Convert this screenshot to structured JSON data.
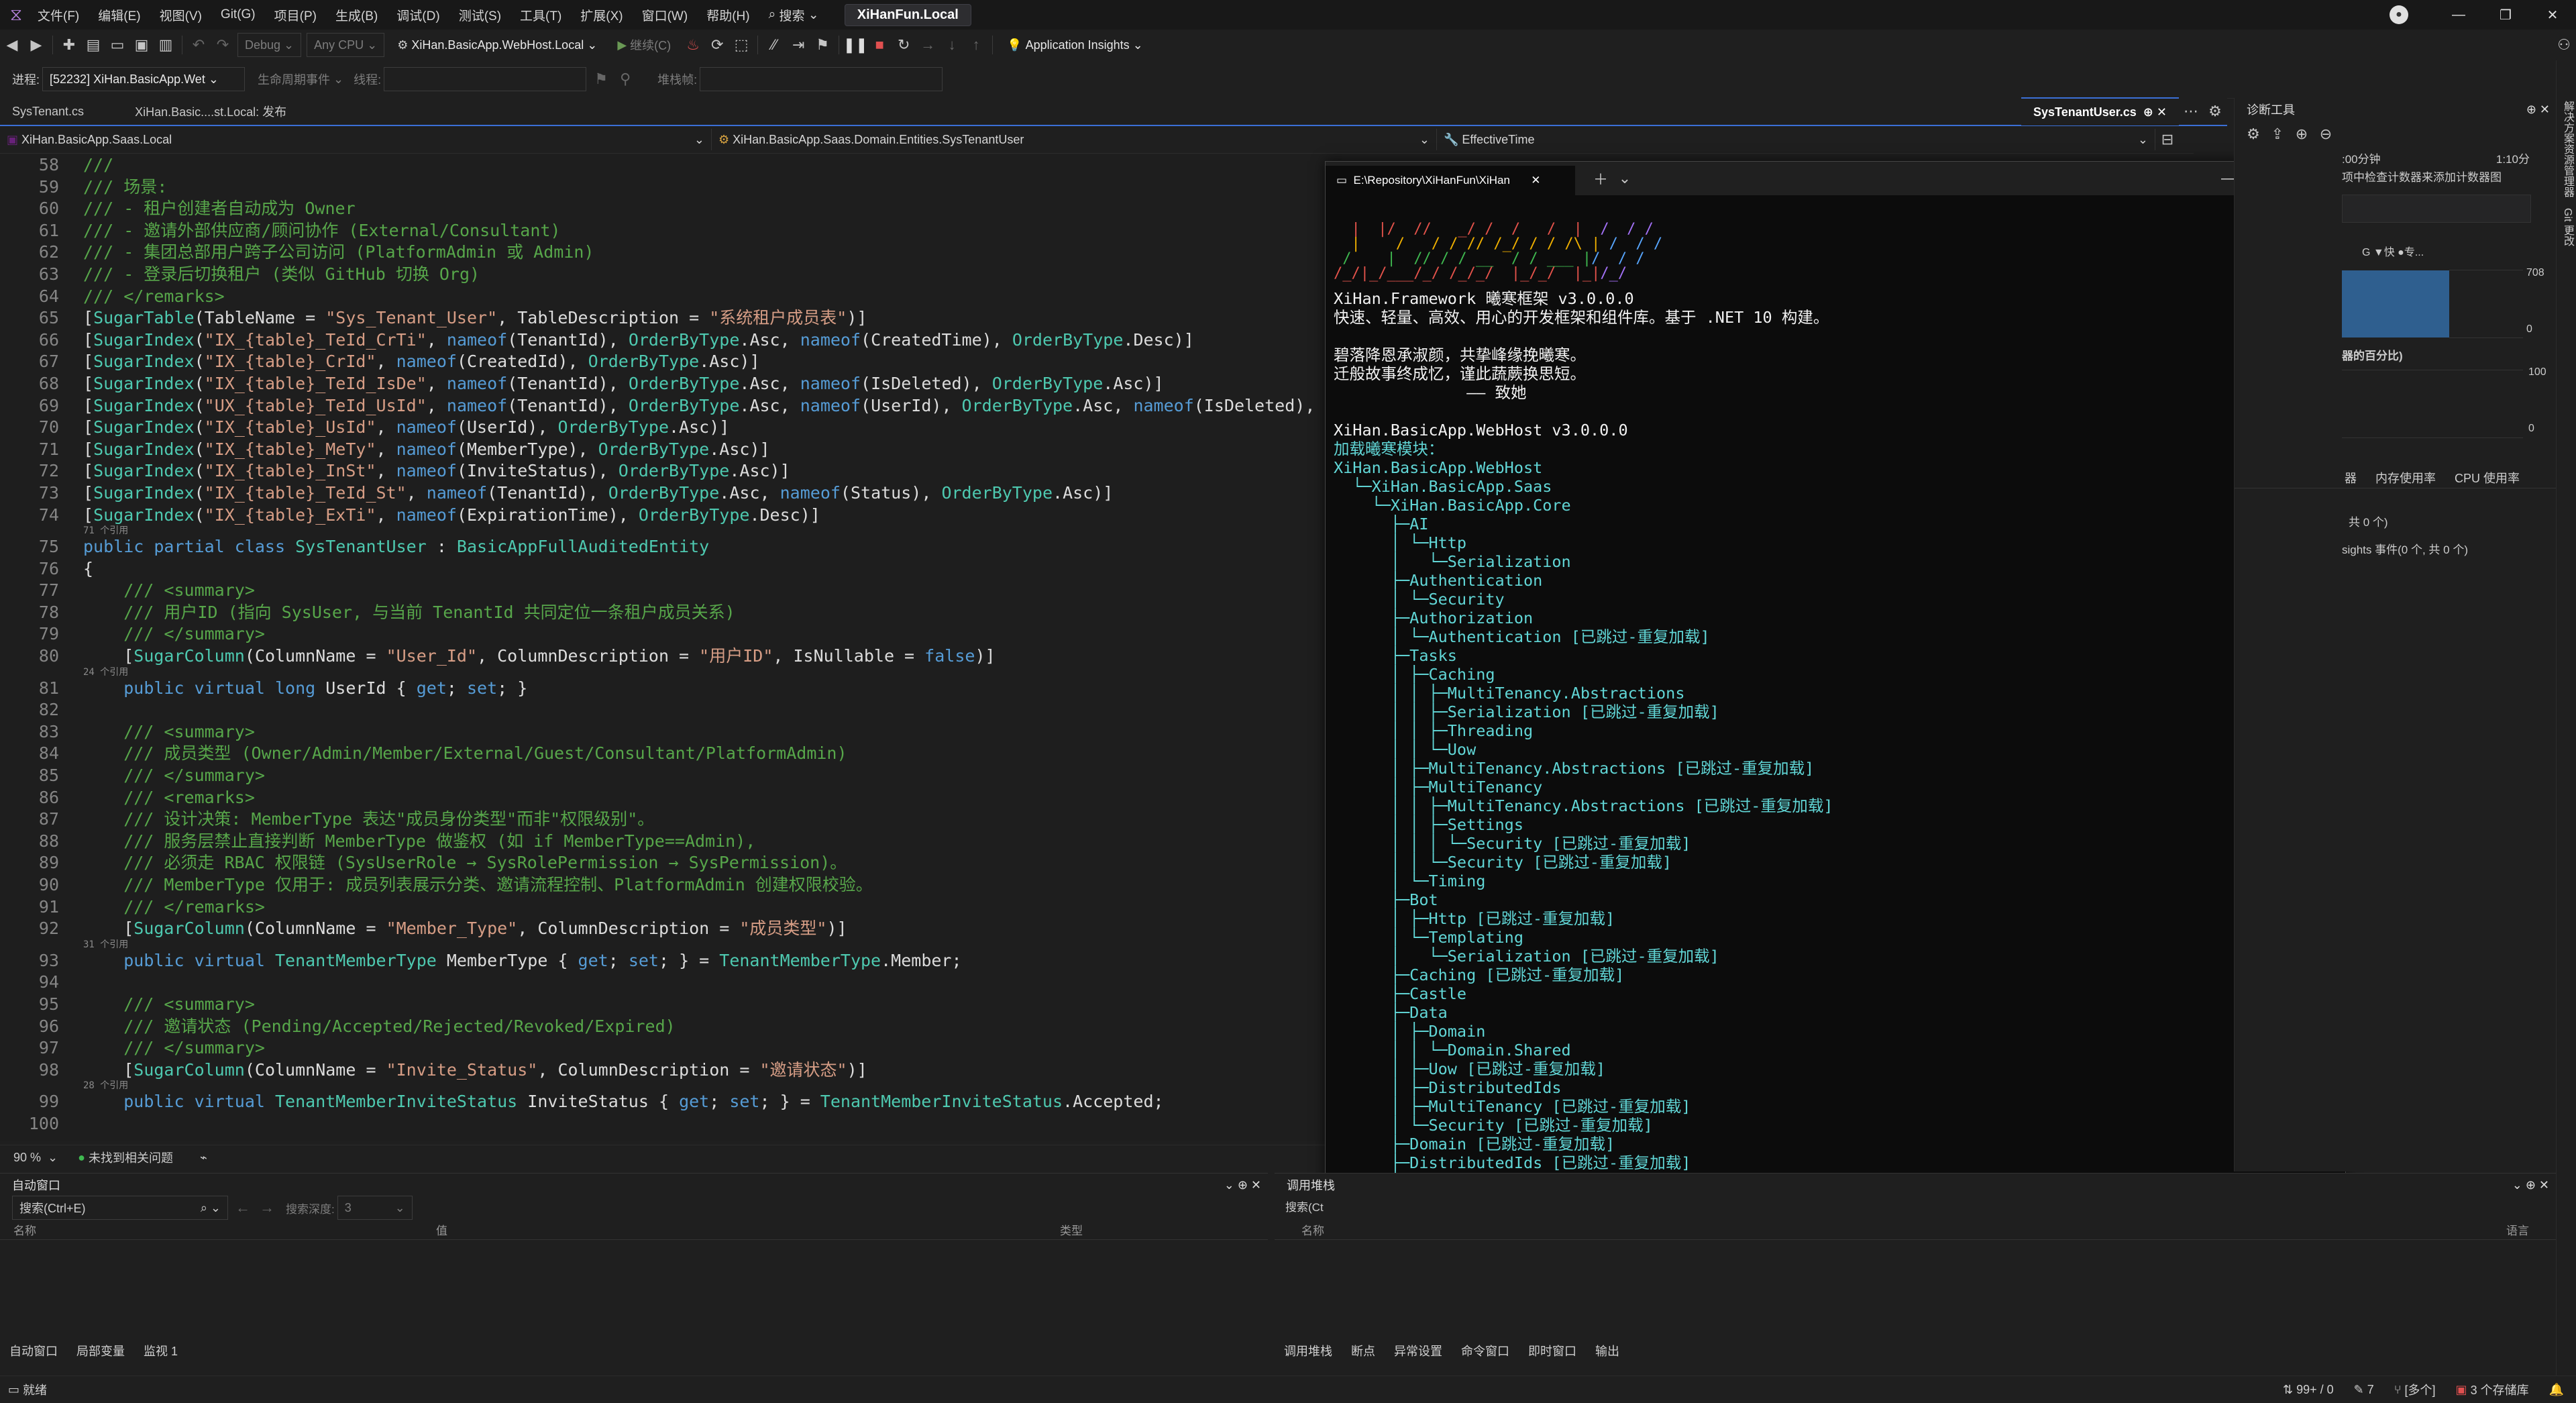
{
  "menubar": {
    "items": [
      "文件(F)",
      "编辑(E)",
      "视图(V)",
      "Git(G)",
      "项目(P)",
      "生成(B)",
      "调试(D)",
      "测试(S)",
      "工具(T)",
      "扩展(X)",
      "窗口(W)",
      "帮助(H)"
    ],
    "search": "搜索",
    "solution_title": "XiHanFun.Local"
  },
  "toolbar": {
    "config": "Debug",
    "platform": "Any CPU",
    "startup": "XiHan.BasicApp.WebHost.Local",
    "continue_label": "继续(C)",
    "app_insights": "Application Insights"
  },
  "procbar": {
    "process_label": "进程:",
    "process_value": "[52232] XiHan.BasicApp.Wet",
    "lifecycle": "生命周期事件",
    "thread_label": "线程:",
    "stack_label": "堆栈帧:"
  },
  "tabs": {
    "left": [
      "SysTenant.cs",
      "XiHan.Basic....st.Local: 发布"
    ],
    "active": "SysTenantUser.cs"
  },
  "navbar": {
    "project": "XiHan.BasicApp.Saas.Local",
    "type": "XiHan.BasicApp.Saas.Domain.Entities.SysTenantUser",
    "member": "EffectiveTime"
  },
  "editor": {
    "zoom": "90 %",
    "issues": "未找到相关问题",
    "hint_71": "71 个引用",
    "hint_24": "24 个引用",
    "hint_31": "31 个引用",
    "hint_28": "28 个引用"
  },
  "console": {
    "tab_title": "E:\\Repository\\XiHanFun\\XiHan",
    "framework_line": "XiHan.Framework 曦寒框架 v3.0.0.0",
    "desc_line": "快速、轻量、高效、用心的开发框架和组件库。基于 .NET 10 构建。",
    "poem1": "碧落降恩承淑颜，共挚峰缘挽曦寒。",
    "poem2": "迁般故事终成忆，谨此蔬蕨换思短。",
    "poem3": "—— 致她",
    "host_line": "XiHan.BasicApp.WebHost v3.0.0.0",
    "loading": "加载曦寒模块："
  },
  "diag": {
    "title": "诊断工具",
    "time_left": ":00分钟",
    "time_right": "1:10分",
    "note": "项中检查计数器来添加计数器图",
    "y708": "708",
    "y0a": "0",
    "y100": "100",
    "y0b": "0",
    "pct_label": "器的百分比)",
    "legend": "G ▼快 ●专...",
    "tabs": [
      "器",
      "内存使用率",
      "CPU 使用率"
    ],
    "count_line": "共 0 个)",
    "insights_line": "sights 事件(0 个, 共 0 个)",
    "side_labels": [
      "解决方案资源管理器",
      "Git 更改"
    ]
  },
  "autos": {
    "title": "自动窗口",
    "search_placeholder": "搜索(Ctrl+E)",
    "depth_label": "搜索深度:",
    "depth_value": "3",
    "col_name": "名称",
    "col_value": "值",
    "col_type": "类型",
    "tabs": [
      "自动窗口",
      "局部变量",
      "监视 1"
    ]
  },
  "callstack": {
    "title": "调用堆栈",
    "search": "搜索(Ct",
    "col_name": "名称",
    "col_lang": "语言",
    "tabs": [
      "调用堆栈",
      "断点",
      "异常设置",
      "命令窗口",
      "即时窗口",
      "输出"
    ]
  },
  "statusbar": {
    "status": "就绪",
    "changes": "99+ / 0",
    "edits": "7",
    "branch": "[多个]",
    "repos": "3 个存储库"
  },
  "colors": {
    "accent": "#3b6fd6",
    "status_green": "#3fb950",
    "console_cyan": "#61d6d6"
  }
}
